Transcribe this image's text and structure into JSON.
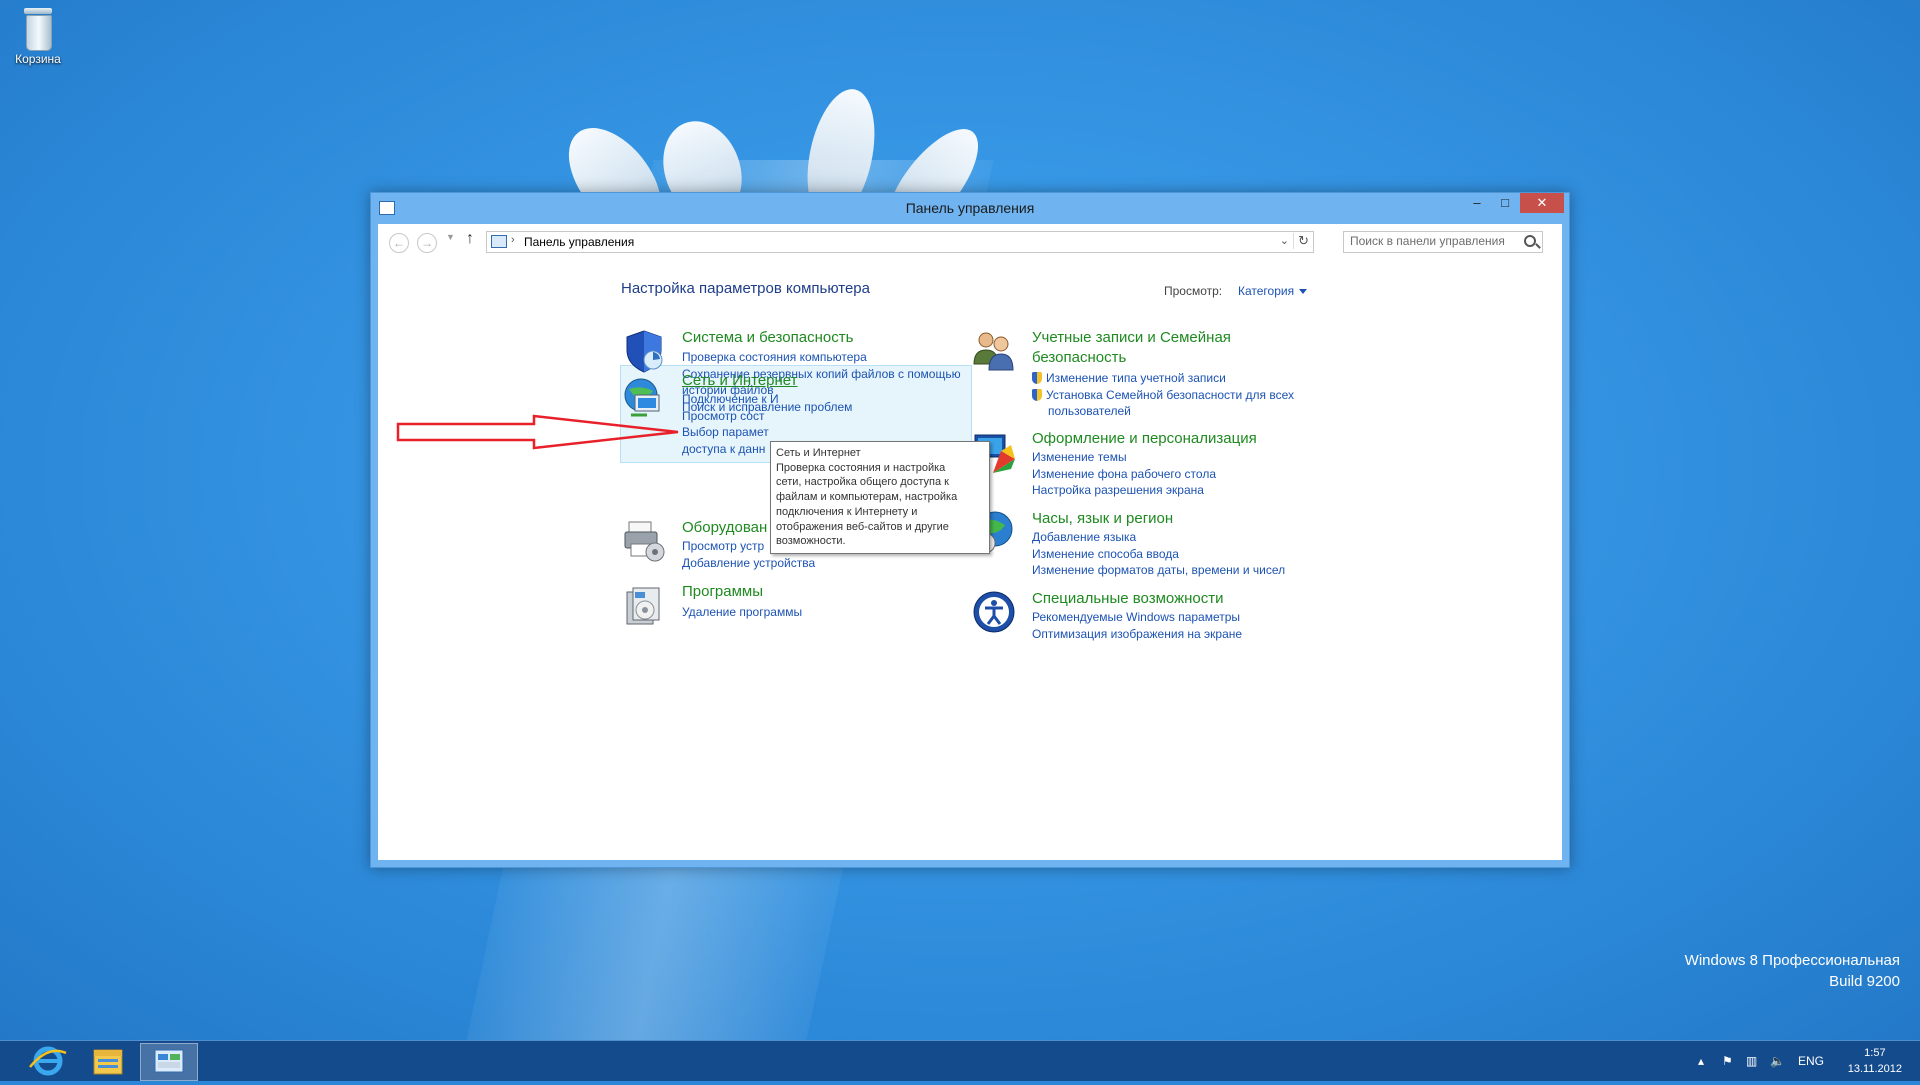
{
  "desktop": {
    "recycle_bin_label": "Корзина",
    "os_edition": "Windows 8 Профессиональная",
    "os_build": "Build 9200"
  },
  "window": {
    "title": "Панель управления",
    "controls": {
      "minimize": "–",
      "maximize": "□",
      "close": "✕"
    }
  },
  "navbar": {
    "address": "Панель управления",
    "search_placeholder": "Поиск в панели управления"
  },
  "content": {
    "heading": "Настройка параметров компьютера",
    "view_by_label": "Просмотр:",
    "view_by_value": "Категория"
  },
  "categories": [
    {
      "title": "Система и безопасность",
      "links": [
        "Проверка состояния компьютера",
        "Сохранение резервных копий файлов с помощью",
        "истории файлов",
        "Поиск и исправление проблем"
      ]
    },
    {
      "title": "Сеть и Интернет",
      "links": [
        "Подключение к И",
        "Просмотр сост",
        "Выбор парамет",
        "доступа к данн"
      ]
    },
    {
      "title": "Оборудован",
      "links": [
        "Просмотр устр",
        "Добавление устройства"
      ]
    },
    {
      "title": "Программы",
      "links": [
        "Удаление программы"
      ]
    },
    {
      "title_line1": "Учетные записи и Семейная",
      "title_line2": "безопасность",
      "links": [
        "Изменение типа учетной записи",
        "Установка Семейной безопасности для всех",
        "пользователей"
      ]
    },
    {
      "title": "Оформление и персонализация",
      "links": [
        "Изменение темы",
        "Изменение фона рабочего стола",
        "Настройка разрешения экрана"
      ]
    },
    {
      "title": "Часы, язык и регион",
      "links": [
        "Добавление языка",
        "Изменение способа ввода",
        "Изменение форматов даты, времени и чисел"
      ]
    },
    {
      "title": "Специальные возможности",
      "links": [
        "Рекомендуемые Windows параметры",
        "Оптимизация изображения на экране"
      ]
    }
  ],
  "tooltip": {
    "lines": [
      "Сеть и Интернет",
      "Проверка состояния и настройка",
      "сети, настройка общего доступа к",
      "файлам и компьютерам, настройка",
      "подключения к Интернету и",
      "отображения веб-сайтов и другие",
      "возможности."
    ]
  },
  "taskbar": {
    "language": "ENG",
    "time": "1:57",
    "date": "13.11.2012"
  },
  "colors": {
    "category_title": "#1f8a20",
    "link": "#1c53b3",
    "heading": "#1e3d8b",
    "arrow": "#e8202a",
    "close_button": "#c7504a"
  }
}
